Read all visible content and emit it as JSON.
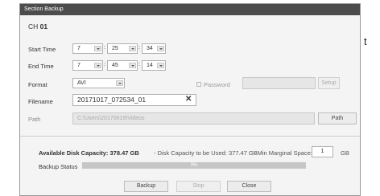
{
  "background_text": "t",
  "window": {
    "title": "Section Backup"
  },
  "channel": {
    "label": "CH",
    "number": "01"
  },
  "start_time": {
    "label": "Start Time",
    "hour": "7",
    "minute": "25",
    "second": "34"
  },
  "end_time": {
    "label": "End Time",
    "hour": "7",
    "minute": "45",
    "second": "14"
  },
  "time_separator": ":",
  "format": {
    "label": "Format",
    "value": "AVI"
  },
  "password": {
    "label": "Password",
    "checked": false,
    "value": "",
    "setup_label": "Setup"
  },
  "filename": {
    "label": "Filename",
    "value": "20171017_072534_01",
    "clear_symbol": "✕"
  },
  "path": {
    "label": "Path",
    "value": "C:\\Users\\20170619\\Videos",
    "button_label": "Path"
  },
  "capacity": {
    "available": "Available Disk Capacity: 378.47 GB",
    "to_be_used": "- Disk Capacity to be Used: 377.47 GB",
    "min_margin_label": "- Min Marginal Space:",
    "min_margin_value": "1",
    "unit": "GB"
  },
  "backup_status": {
    "label": "Backup Status",
    "progress": 0,
    "text": "0%"
  },
  "buttons": {
    "backup": "Backup",
    "stop": "Stop",
    "close": "Close"
  },
  "colors": {
    "titlebar": "#4c4c4c",
    "dialog_bg": "#f4f4f4",
    "progress_bg": "#c6c6c6"
  }
}
